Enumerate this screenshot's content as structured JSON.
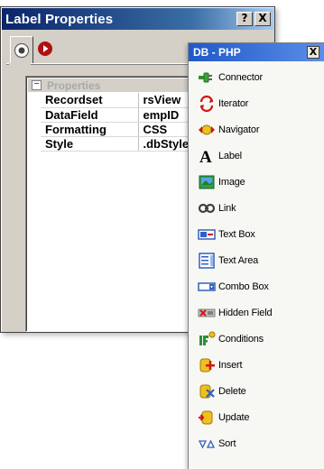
{
  "label_properties": {
    "title": "Label Properties",
    "help_button": "?",
    "close_button": "X",
    "section_title": "Properties",
    "expander": "−",
    "rows": [
      {
        "key": "Recordset",
        "value": "rsView"
      },
      {
        "key": "DataField",
        "value": "empID"
      },
      {
        "key": "Formatting",
        "value": "CSS"
      },
      {
        "key": "Style",
        "value": ".dbStyle"
      }
    ]
  },
  "db_palette": {
    "title": "DB - PHP",
    "close_button": "X",
    "items": [
      {
        "label": "Connector",
        "icon": "connector-icon"
      },
      {
        "label": "Iterator",
        "icon": "iterator-icon"
      },
      {
        "label": "Navigator",
        "icon": "navigator-icon"
      },
      {
        "label": "Label",
        "icon": "label-icon"
      },
      {
        "label": "Image",
        "icon": "image-icon"
      },
      {
        "label": "Link",
        "icon": "link-icon"
      },
      {
        "label": "Text Box",
        "icon": "text-box-icon"
      },
      {
        "label": "Text Area",
        "icon": "text-area-icon"
      },
      {
        "label": "Combo Box",
        "icon": "combo-box-icon"
      },
      {
        "label": "Hidden Field",
        "icon": "hidden-field-icon"
      },
      {
        "label": "Conditions",
        "icon": "conditions-icon"
      },
      {
        "label": "Insert",
        "icon": "insert-icon"
      },
      {
        "label": "Delete",
        "icon": "delete-icon"
      },
      {
        "label": "Update",
        "icon": "update-icon"
      },
      {
        "label": "Sort",
        "icon": "sort-icon"
      }
    ]
  },
  "colors": {
    "title_bar": "#0a246a",
    "palette_title_bar": "#2058c8",
    "window_face": "#d4d0c8"
  }
}
